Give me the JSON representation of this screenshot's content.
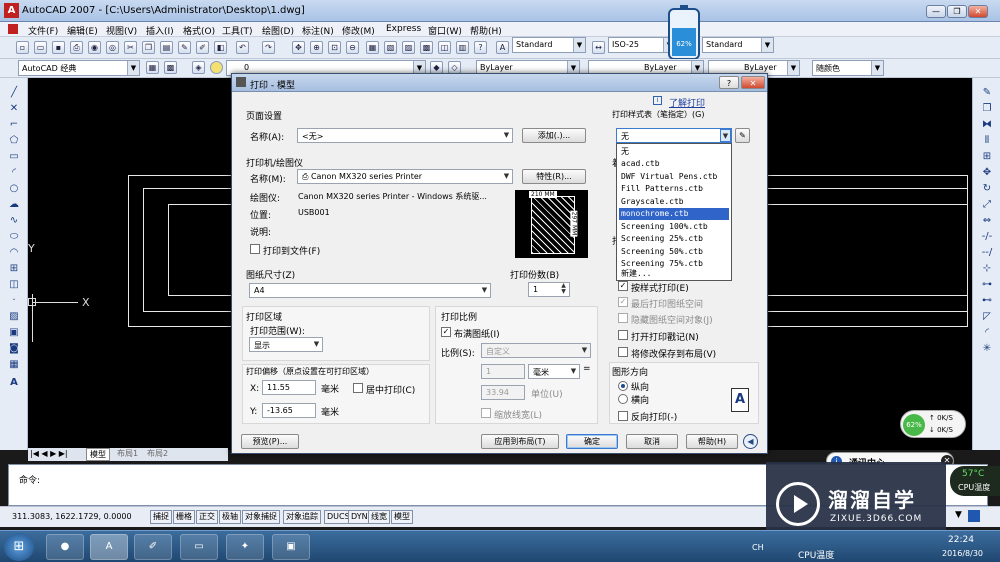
{
  "app": {
    "title": "AutoCAD 2007 - [C:\\Users\\Administrator\\Desktop\\1.dwg]",
    "win_min": "—",
    "win_max": "❐",
    "win_close": "✕",
    "logo": "A"
  },
  "menu": [
    "文件(F)",
    "编辑(E)",
    "视图(V)",
    "插入(I)",
    "格式(O)",
    "工具(T)",
    "绘图(D)",
    "标注(N)",
    "修改(M)",
    "Express",
    "窗口(W)",
    "帮助(H)"
  ],
  "toolbar": {
    "text_style": "Standard",
    "dim_style": "ISO-25",
    "table_style": "Standard",
    "workspace": "AutoCAD 经典",
    "layer": "0",
    "color": "ByLayer",
    "linetype": "ByLayer",
    "lineweight": "ByLayer",
    "plotstyle": "随颜色"
  },
  "battery": {
    "percent": "62%"
  },
  "canvas": {
    "axis_y": "Y",
    "axis_x": "X"
  },
  "layout_tabs": [
    "模型",
    "布局1",
    "布局2"
  ],
  "dialog": {
    "title": "打印 - 模型",
    "help_link": "了解打印",
    "page_setup": {
      "heading": "页面设置",
      "name_label": "名称(A):",
      "name_value": "<无>",
      "add_button": "添加(.)..."
    },
    "printer": {
      "heading": "打印机/绘图仪",
      "name_label": "名称(M):",
      "name_value": "Canon MX320 series Printer",
      "properties_button": "特性(R)...",
      "plotter_label": "绘图仪:",
      "plotter_value": "Canon MX320 series Printer - Windows 系统驱...",
      "location_label": "位置:",
      "location_value": "USB001",
      "desc_label": "说明:",
      "plot_to_file": "打印到文件(F)",
      "preview_width": "210 MM",
      "preview_height": "297 MM"
    },
    "paper_size": {
      "heading": "图纸尺寸(Z)",
      "value": "A4"
    },
    "copies": {
      "heading": "打印份数(B)",
      "value": "1"
    },
    "plot_area": {
      "heading": "打印区域",
      "range_label": "打印范围(W):",
      "range_value": "显示"
    },
    "plot_offset": {
      "heading": "打印偏移（原点设置在可打印区域）",
      "x_label": "X:",
      "x_value": "11.55",
      "x_unit": "毫米",
      "center_label": "居中打印(C)",
      "y_label": "Y:",
      "y_value": "-13.65",
      "y_unit": "毫米"
    },
    "plot_scale": {
      "heading": "打印比例",
      "fit_label": "布满图纸(I)",
      "scale_label": "比例(S):",
      "scale_value": "自定义",
      "num_value": "1",
      "unit_value": "毫米",
      "equals": "=",
      "denom_value": "33.94",
      "unit_label": "单位(U)",
      "lineweights_label": "缩放线宽(L)"
    },
    "plot_style_table": {
      "heading": "打印样式表（笔指定）(G)",
      "value": "无",
      "options": [
        "无",
        "acad.ctb",
        "DWF Virtual Pens.ctb",
        "Fill Patterns.ctb",
        "Grayscale.ctb",
        "monochrome.ctb",
        "Screening 100%.ctb",
        "Screening 25%.ctb",
        "Screening 50%.ctb",
        "Screening 75%.ctb",
        "新建..."
      ],
      "selected_index": 5
    },
    "plot_options": {
      "partial_a": "着",
      "partial_b": "打",
      "plot_with_styles": "按样式打印(E)",
      "paperspace_last": "最后打印图纸空间",
      "hide_objects": "隐藏图纸空间对象(J)",
      "plot_stamp": "打开打印戳记(N)",
      "save_changes": "将修改保存到布局(V)"
    },
    "orientation": {
      "heading": "图形方向",
      "portrait": "纵向",
      "landscape": "横向",
      "upside_down": "反向打印(-)",
      "icon": "A"
    },
    "buttons": {
      "preview": "预览(P)...",
      "apply": "应用到布局(T)",
      "ok": "确定",
      "cancel": "取消",
      "help": "帮助(H)"
    }
  },
  "command": {
    "prompt": "命令:"
  },
  "status": {
    "coords": "311.3083,   1622.1729, 0.0000",
    "modes": [
      "捕捉",
      "栅格",
      "正交",
      "极轴",
      "对象捕捉",
      "对象追踪",
      "DUCS",
      "DYN",
      "线宽",
      "模型"
    ]
  },
  "network": {
    "percent": "62%",
    "up": "0K/S",
    "down": "0K/S"
  },
  "notify": {
    "label": "通讯中心"
  },
  "cpu": {
    "temp": "57°C",
    "label": "CPU温度"
  },
  "watermark": {
    "brand": "溜溜自学",
    "url": "ZIXUE.3D66.COM"
  },
  "tray": {
    "cpu_label": "CPU温度",
    "time": "22:24",
    "date": "2016/8/30",
    "lang": "CH"
  },
  "taskbar": {
    "start": "⊞"
  }
}
